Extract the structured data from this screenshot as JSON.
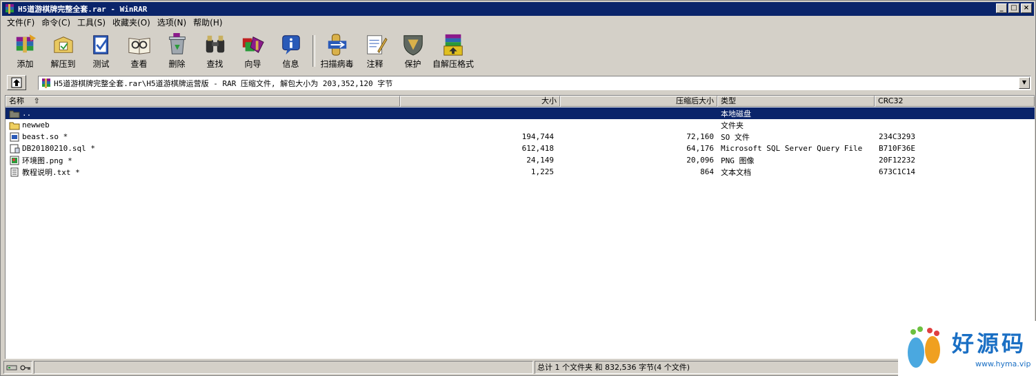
{
  "window": {
    "title": "H5道游棋牌完整全套.rar - WinRAR",
    "controls": [
      "_",
      "□",
      "×"
    ]
  },
  "menu": [
    "文件(F)",
    "命令(C)",
    "工具(S)",
    "收藏夹(O)",
    "选项(N)",
    "帮助(H)"
  ],
  "toolbar": {
    "buttons": [
      {
        "label": "添加",
        "icon": "add-archive-icon"
      },
      {
        "label": "解压到",
        "icon": "extract-to-icon"
      },
      {
        "label": "测试",
        "icon": "test-icon"
      },
      {
        "label": "查看",
        "icon": "view-icon"
      },
      {
        "label": "删除",
        "icon": "delete-icon"
      },
      {
        "label": "查找",
        "icon": "find-icon"
      },
      {
        "label": "向导",
        "icon": "wizard-icon"
      },
      {
        "label": "信息",
        "icon": "info-icon"
      },
      {
        "label": "扫描病毒",
        "icon": "virus-scan-icon"
      },
      {
        "label": "注释",
        "icon": "comment-icon"
      },
      {
        "label": "保护",
        "icon": "protect-icon"
      },
      {
        "label": "自解压格式",
        "icon": "sfx-icon"
      }
    ]
  },
  "address": {
    "path": "H5道游棋牌完整全套.rar\\H5道游棋牌运营版 - RAR 压缩文件, 解包大小为 203,352,120 字节"
  },
  "columns": {
    "name": "名称",
    "size": "大小",
    "packed": "压缩后大小",
    "type": "类型",
    "crc": "CRC32"
  },
  "files": [
    {
      "name": "..",
      "size": "",
      "packed": "",
      "type": "本地磁盘",
      "crc": "",
      "icon": "folder-up-icon",
      "selected": true
    },
    {
      "name": "newweb",
      "size": "",
      "packed": "",
      "type": "文件夹",
      "crc": "",
      "icon": "folder-icon",
      "selected": false
    },
    {
      "name": "beast.so *",
      "size": "194,744",
      "packed": "72,160",
      "type": "SO 文件",
      "crc": "234C3293",
      "icon": "file-so-icon",
      "selected": false
    },
    {
      "name": "DB20180210.sql *",
      "size": "612,418",
      "packed": "64,176",
      "type": "Microsoft SQL Server Query File",
      "crc": "B710F36E",
      "icon": "file-sql-icon",
      "selected": false
    },
    {
      "name": "环境图.png *",
      "size": "24,149",
      "packed": "20,096",
      "type": "PNG 图像",
      "crc": "20F12232",
      "icon": "file-png-icon",
      "selected": false
    },
    {
      "name": "教程说明.txt *",
      "size": "1,225",
      "packed": "864",
      "type": "文本文档",
      "crc": "673C1C14",
      "icon": "file-txt-icon",
      "selected": false
    }
  ],
  "status": {
    "summary": "总计 1 个文件夹 和 832,536 字节(4 个文件)"
  },
  "watermark": {
    "brand": "好源码",
    "url": "www.hyma.vip"
  }
}
